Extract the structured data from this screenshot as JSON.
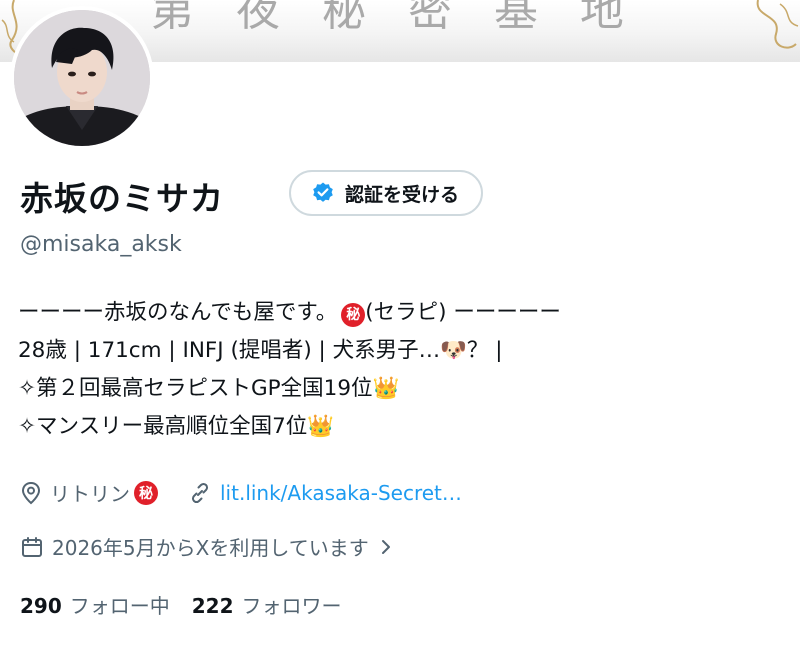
{
  "banner": {
    "text": "第 夜 秘 密 基 地"
  },
  "profile": {
    "display_name": "赤坂のミサカ",
    "verify_button": "認証を受ける",
    "handle": "@misaka_aksk"
  },
  "bio": {
    "line1": {
      "before": "ーーーー赤坂のなんでも屋です。",
      "seal": "秘",
      "after": "(セラピ) ーーーーー"
    },
    "line2": {
      "text": "28歳 | 171cm | INFJ (提唱者) | 犬系男子…",
      "emoji": "🐶",
      "after": "？ |"
    },
    "line3": {
      "text": "✧第２回最高セラピストGP全国19位",
      "emoji": "👑"
    },
    "line4": {
      "text": "✧マンスリー最高順位全国7位",
      "emoji": "👑"
    }
  },
  "meta": {
    "location": "リトリン",
    "location_seal": "秘",
    "link": "lit.link/Akasaka-Secret…",
    "joined": "2026年5月からXを利用しています"
  },
  "stats": {
    "following_count": "290",
    "following_label": "フォロー中",
    "followers_count": "222",
    "followers_label": "フォロワー"
  },
  "icons": {
    "verify": "verified-badge-icon",
    "location": "location-pin-icon",
    "link": "link-icon",
    "calendar": "calendar-icon",
    "chevron": "chevron-right-icon"
  },
  "colors": {
    "accent": "#1d9bf0",
    "secondary_text": "#536471",
    "seal_red": "#e0202a"
  }
}
